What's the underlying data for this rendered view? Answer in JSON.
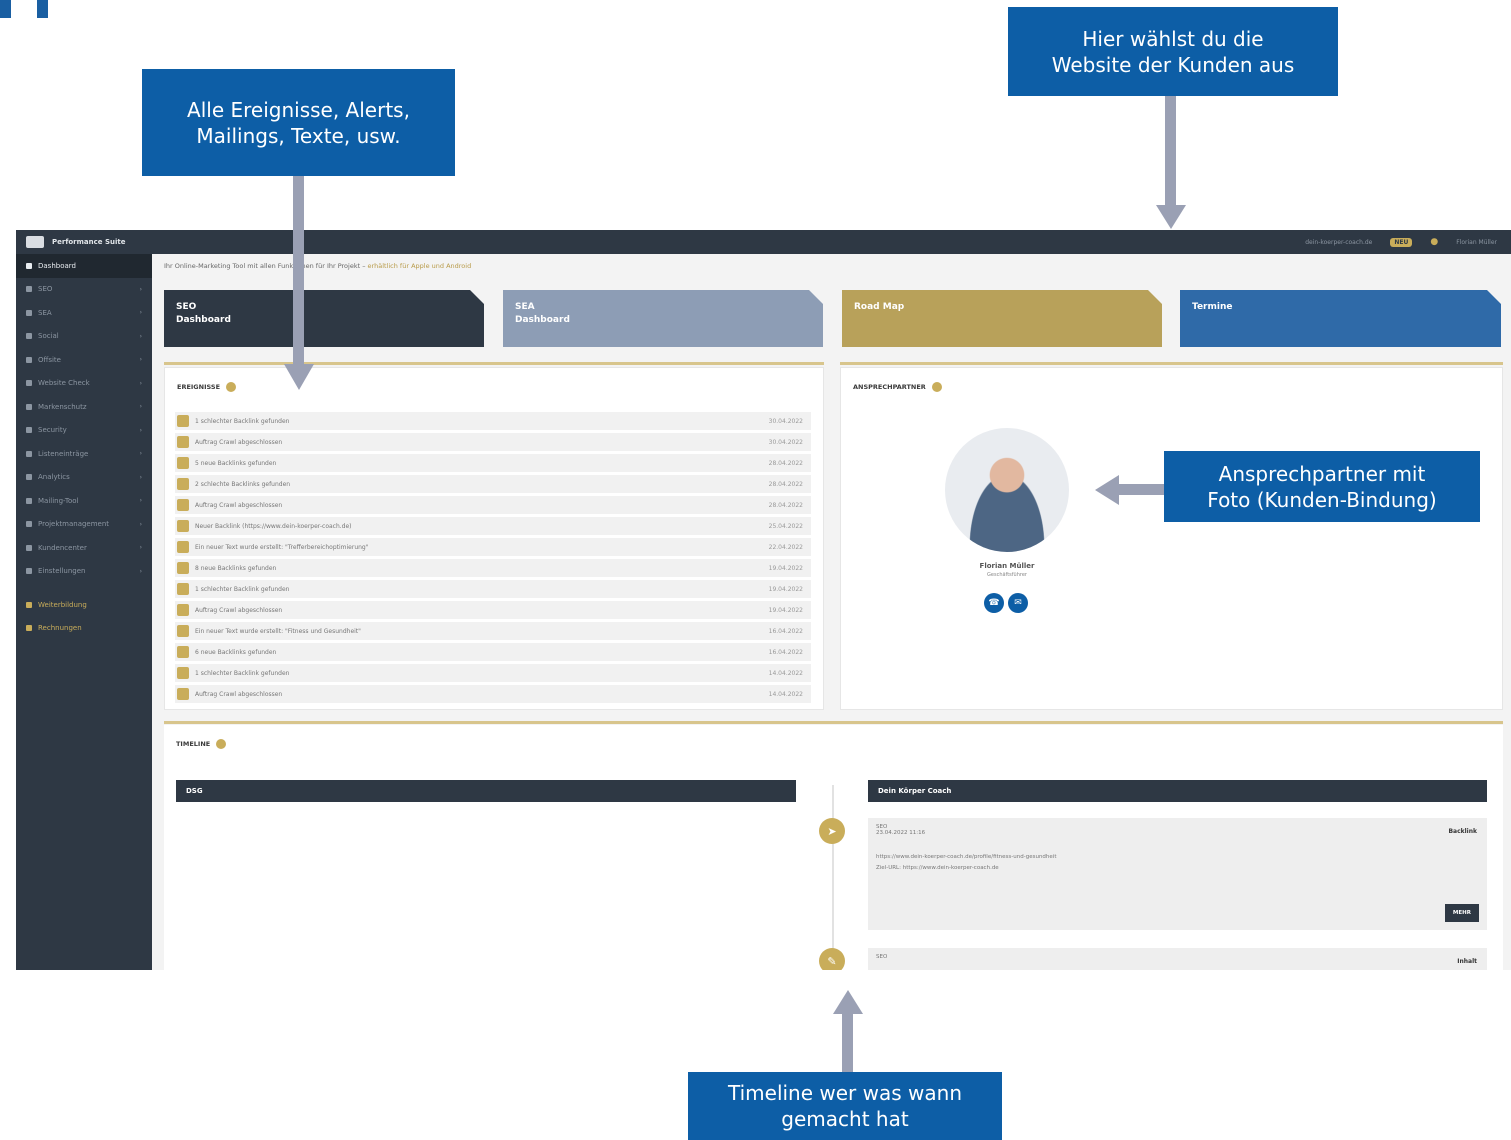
{
  "callouts": {
    "events_line1": "Alle Ereignisse, Alerts,",
    "events_line2": "Mailings, Texte, usw.",
    "website_line1": "Hier wählst du die",
    "website_line2": "Website der Kunden aus",
    "contact_line1": "Ansprechpartner mit",
    "contact_line2": "Foto (Kunden-Bindung)",
    "timeline_line1": "Timeline wer was wann",
    "timeline_line2": "gemacht hat"
  },
  "colors": {
    "callout_bg": "#0d5ea6",
    "arrow": "#9aa0b4",
    "sidebar": "#2e3844",
    "gold": "#c9ad5a",
    "tile_sea": "#8d9db5",
    "tile_roadmap": "#b8a15a",
    "tile_termine": "#2f6aa8"
  },
  "app": {
    "brand": "Performance Suite",
    "sidebar": [
      {
        "label": "Dashboard",
        "icon": "home-icon"
      },
      {
        "label": "SEO",
        "icon": "search-icon"
      },
      {
        "label": "SEA",
        "icon": "ads-icon"
      },
      {
        "label": "Social",
        "icon": "social-icon"
      },
      {
        "label": "Offsite",
        "icon": "link-icon"
      },
      {
        "label": "Website Check",
        "icon": "check-icon"
      },
      {
        "label": "Markenschutz",
        "icon": "shield-icon"
      },
      {
        "label": "Security",
        "icon": "lock-icon"
      },
      {
        "label": "Listeneinträge",
        "icon": "list-icon"
      },
      {
        "label": "Analytics",
        "icon": "chart-icon"
      },
      {
        "label": "Mailing-Tool",
        "icon": "mail-icon"
      },
      {
        "label": "Projektmanagement",
        "icon": "briefcase-icon"
      },
      {
        "label": "Kundencenter",
        "icon": "users-icon"
      },
      {
        "label": "Einstellungen",
        "icon": "gear-icon"
      }
    ],
    "sidebar_extra": [
      "Weiterbildung",
      "Rechnungen"
    ],
    "topbar": {
      "site": "dein-koerper-coach.de",
      "badge": "NEU",
      "user": "Florian Müller"
    },
    "notice": "Ihr Online-Marketing Tool mit allen Funktionen für Ihr Projekt",
    "notice_link": "erhältlich für Apple und Android",
    "tiles": [
      {
        "line1": "SEO",
        "line2": "Dashboard"
      },
      {
        "line1": "SEA",
        "line2": "Dashboard"
      },
      {
        "line1": "Road Map",
        "line2": ""
      },
      {
        "line1": "Termine",
        "line2": ""
      }
    ],
    "events_title": "EREIGNISSE",
    "events": [
      {
        "text": "1 schlechter Backlink gefunden",
        "date": "30.04.2022"
      },
      {
        "text": "Auftrag Crawl abgeschlossen",
        "date": "30.04.2022"
      },
      {
        "text": "5 neue Backlinks gefunden",
        "date": "28.04.2022"
      },
      {
        "text": "2 schlechte Backlinks gefunden",
        "date": "28.04.2022"
      },
      {
        "text": "Auftrag Crawl abgeschlossen",
        "date": "28.04.2022"
      },
      {
        "text": "Neuer Backlink (https://www.dein-koerper-coach.de)",
        "date": "25.04.2022"
      },
      {
        "text": "Ein neuer Text wurde erstellt: \"Trefferbereichoptimierung\"",
        "date": "22.04.2022"
      },
      {
        "text": "8 neue Backlinks gefunden",
        "date": "19.04.2022"
      },
      {
        "text": "1 schlechter Backlink gefunden",
        "date": "19.04.2022"
      },
      {
        "text": "Auftrag Crawl abgeschlossen",
        "date": "19.04.2022"
      },
      {
        "text": "Ein neuer Text wurde erstellt: \"Fitness und Gesundheit\"",
        "date": "16.04.2022"
      },
      {
        "text": "6 neue Backlinks gefunden",
        "date": "16.04.2022"
      },
      {
        "text": "1 schlechter Backlink gefunden",
        "date": "14.04.2022"
      },
      {
        "text": "Auftrag Crawl abgeschlossen",
        "date": "14.04.2022"
      }
    ],
    "contact_title": "ANSPRECHPARTNER",
    "contact_name": "Florian Müller",
    "contact_role": "Geschäftsführer",
    "timeline_title": "TIMELINE",
    "timeline_left_head": "DSG",
    "timeline_right_head": "Dein Körper Coach",
    "timeline_card1": {
      "meta1": "SEO",
      "meta2": "23.04.2022 11:16",
      "tag": "Backlink",
      "url": "https://www.dein-koerper-coach.de/profile/fitness-und-gesundheit",
      "target": "Ziel-URL: https://www.dein-koerper-coach.de",
      "more": "MEHR"
    },
    "timeline_card2": {
      "meta1": "SEO",
      "tag": "Inhalt"
    }
  }
}
